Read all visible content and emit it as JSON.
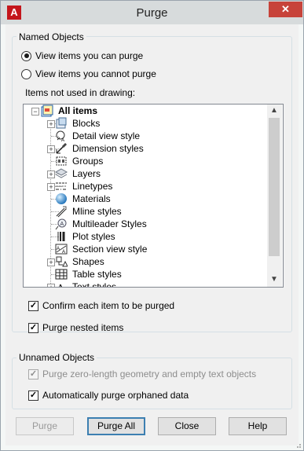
{
  "window": {
    "title": "Purge",
    "app_icon_letter": "A",
    "close_glyph": "✕"
  },
  "named_objects": {
    "label": "Named Objects",
    "radio_can_purge": "View items you can purge",
    "radio_cannot_purge": "View items you cannot purge",
    "selected_radio": "can_purge",
    "items_label": "Items not used in drawing:",
    "tree": {
      "root": {
        "label": "All items",
        "icon": "all-items-icon",
        "expander": "⊟"
      },
      "items": [
        {
          "label": "Blocks",
          "icon": "blocks-icon",
          "expandable": true
        },
        {
          "label": "Detail view style",
          "icon": "detail-view-style-icon",
          "expandable": false
        },
        {
          "label": "Dimension styles",
          "icon": "dimension-styles-icon",
          "expandable": true
        },
        {
          "label": "Groups",
          "icon": "groups-icon",
          "expandable": false
        },
        {
          "label": "Layers",
          "icon": "layers-icon",
          "expandable": true
        },
        {
          "label": "Linetypes",
          "icon": "linetypes-icon",
          "expandable": true
        },
        {
          "label": "Materials",
          "icon": "materials-icon",
          "expandable": false
        },
        {
          "label": "Mline styles",
          "icon": "mline-styles-icon",
          "expandable": false
        },
        {
          "label": "Multileader Styles",
          "icon": "multileader-styles-icon",
          "expandable": false
        },
        {
          "label": "Plot styles",
          "icon": "plot-styles-icon",
          "expandable": false
        },
        {
          "label": "Section view style",
          "icon": "section-view-style-icon",
          "expandable": false
        },
        {
          "label": "Shapes",
          "icon": "shapes-icon",
          "expandable": true
        },
        {
          "label": "Table styles",
          "icon": "table-styles-icon",
          "expandable": false
        },
        {
          "label": "Text styles",
          "icon": "text-styles-icon",
          "expandable": true
        }
      ]
    },
    "confirm_each": {
      "label": "Confirm each item to be purged",
      "checked": true
    },
    "purge_nested": {
      "label": "Purge nested items",
      "checked": true
    }
  },
  "unnamed_objects": {
    "label": "Unnamed Objects",
    "zero_length": {
      "label": "Purge zero-length geometry and empty text objects",
      "checked": true,
      "enabled": false
    },
    "orphaned": {
      "label": "Automatically purge orphaned data",
      "checked": true
    }
  },
  "buttons": {
    "purge": "Purge",
    "purge_all": "Purge All",
    "close": "Close",
    "help": "Help"
  },
  "glyphs": {
    "check": "✓",
    "plus": "+",
    "scroll_up": "▲",
    "scroll_down": "▼"
  },
  "colors": {
    "title_bar": "#d7dbdc",
    "close_button": "#c7433a",
    "app_icon": "#c4161c",
    "default_button_border": "#3c7fb1"
  }
}
